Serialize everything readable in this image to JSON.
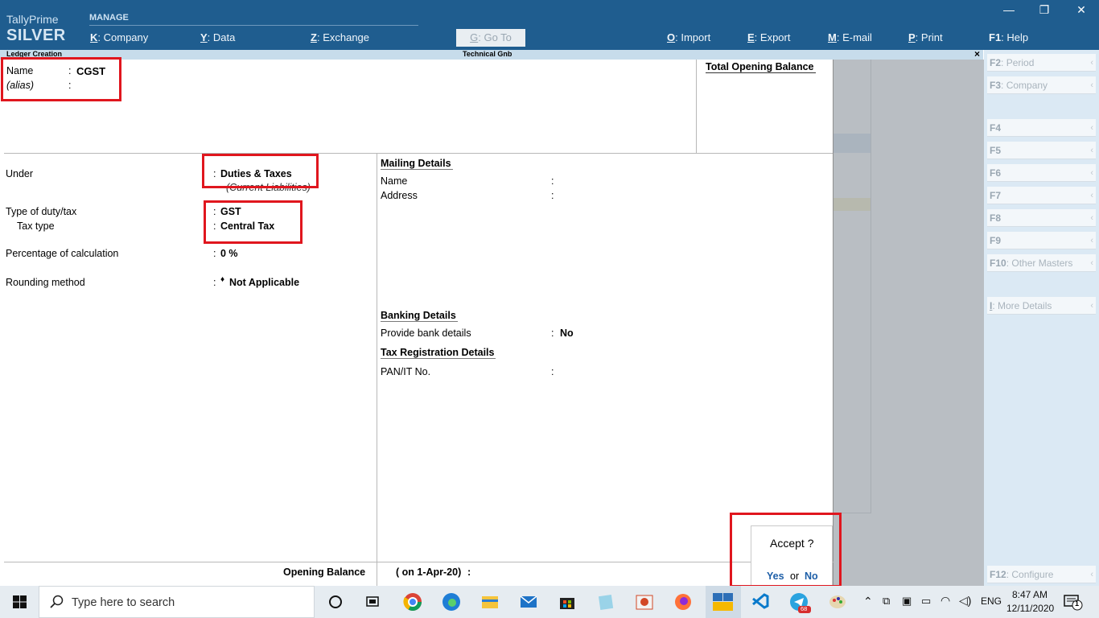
{
  "app": {
    "brand_top": "TallyPrime",
    "brand_edition": "SILVER",
    "manage_label": "MANAGE",
    "menu": [
      {
        "key": "K",
        "label": "Company"
      },
      {
        "key": "Y",
        "label": "Data"
      },
      {
        "key": "Z",
        "label": "Exchange"
      },
      {
        "key": "G",
        "label": "Go To"
      },
      {
        "key": "O",
        "label": "Import"
      },
      {
        "key": "E",
        "label": "Export"
      },
      {
        "key": "M",
        "label": "E-mail"
      },
      {
        "key": "P",
        "label": "Print"
      },
      {
        "key": "F1",
        "label": "Help"
      }
    ],
    "window_controls": [
      "—",
      "❐",
      "✕"
    ]
  },
  "screen": {
    "title": "Ledger Creation",
    "company": "Technical Gnb",
    "close": "×"
  },
  "ledger": {
    "name_label": "Name",
    "name_value": "CGST",
    "alias_label": "(alias)",
    "total_opening_balance_label": "Total Opening Balance",
    "under_label": "Under",
    "under_value": "Duties & Taxes",
    "under_sub": "(Current Liabilities)",
    "duty_type_label": "Type of duty/tax",
    "duty_type_value": "GST",
    "tax_type_label": "Tax type",
    "tax_type_value": "Central Tax",
    "percentage_label": "Percentage of calculation",
    "percentage_value": "0 %",
    "rounding_label": "Rounding method",
    "rounding_value": "Not Applicable",
    "colon": ":"
  },
  "mailing": {
    "heading": "Mailing Details",
    "name_label": "Name",
    "address_label": "Address"
  },
  "banking": {
    "heading": "Banking Details",
    "provide_label": "Provide bank details",
    "provide_value": "No"
  },
  "tax_reg": {
    "heading": "Tax Registration Details",
    "pan_label": "PAN/IT No."
  },
  "opening": {
    "label": "Opening Balance",
    "date": "( on 1-Apr-20)",
    "colon": ":"
  },
  "accept_dialog": {
    "question": "Accept ?",
    "yes": "Yes",
    "or": "or",
    "no": "No"
  },
  "right_panel": [
    {
      "key": "F2",
      "label": "Period"
    },
    {
      "key": "F3",
      "label": "Company"
    },
    {
      "key": "F4",
      "label": ""
    },
    {
      "key": "F5",
      "label": ""
    },
    {
      "key": "F6",
      "label": ""
    },
    {
      "key": "F7",
      "label": ""
    },
    {
      "key": "F8",
      "label": ""
    },
    {
      "key": "F9",
      "label": ""
    },
    {
      "key": "F10",
      "label": "Other Masters"
    },
    {
      "key": "I",
      "label": "More Details"
    },
    {
      "key": "F12",
      "label": "Configure"
    }
  ],
  "taskbar": {
    "search_placeholder": "Type here to search",
    "language": "ENG",
    "time": "8:47 AM",
    "date": "12/11/2020",
    "notification_count": "1",
    "telegram_badge": "68"
  },
  "colors": {
    "header_bg": "#1f5d8f",
    "highlight_red": "#e0161e",
    "accept_blue": "#1e5fa8"
  }
}
